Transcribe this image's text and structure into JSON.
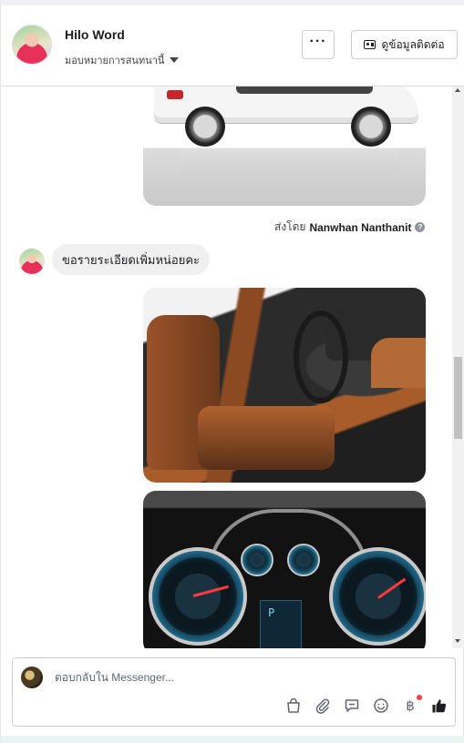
{
  "header": {
    "name": "Hilo Word",
    "assign_label": "มอบหมายการสนทนานี้",
    "more_label": "···",
    "contact_label": "ดูข้อมูลติดต่อ"
  },
  "messages": {
    "sent_by_prefix": "ส่งโดย",
    "sent_by_name": "Nanwhan Nanthanit",
    "sent_by_help": "?",
    "customer_text": "ขอรายระเอียดเพิ่มหน่อยคะ"
  },
  "composer": {
    "placeholder": "ตอบกลับใน Messenger...",
    "currency_symbol": "฿",
    "tools": [
      "shopping-bag-icon",
      "attachment-icon",
      "saved-reply-icon",
      "emoji-icon",
      "payment-icon",
      "like-icon"
    ]
  },
  "colors": {
    "accent": "#1c1e21",
    "border": "#ccd0d5",
    "bubble": "#f0f0f0",
    "notification": "#fa3e3e"
  }
}
